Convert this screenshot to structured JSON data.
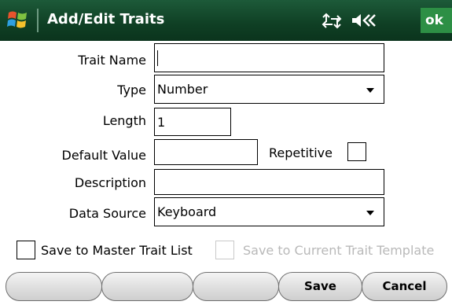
{
  "titlebar": {
    "title": "Add/Edit Traits",
    "ok_label": "ok",
    "icons": [
      "windows-start-icon",
      "connectivity-icon",
      "speaker-icon"
    ]
  },
  "form": {
    "trait_name": {
      "label": "Trait Name",
      "value": ""
    },
    "type": {
      "label": "Type",
      "value": "Number"
    },
    "length": {
      "label": "Length",
      "value": "1"
    },
    "default_value": {
      "label": "Default Value",
      "value": ""
    },
    "repetitive": {
      "label": "Repetitive",
      "checked": false
    },
    "description": {
      "label": "Description",
      "value": ""
    },
    "data_source": {
      "label": "Data Source",
      "value": "Keyboard"
    }
  },
  "options": {
    "save_master": {
      "label": "Save to Master Trait List",
      "checked": false,
      "enabled": true
    },
    "save_template": {
      "label": "Save to Current Trait Template",
      "checked": false,
      "enabled": false
    }
  },
  "softkeys": {
    "key1": "",
    "key2": "",
    "key3": "",
    "save": "Save",
    "cancel": "Cancel"
  },
  "colors": {
    "titlebar_bg": "#0f3f24",
    "ok_bg": "#2d8f45",
    "disabled_text": "#b9b9b9"
  }
}
